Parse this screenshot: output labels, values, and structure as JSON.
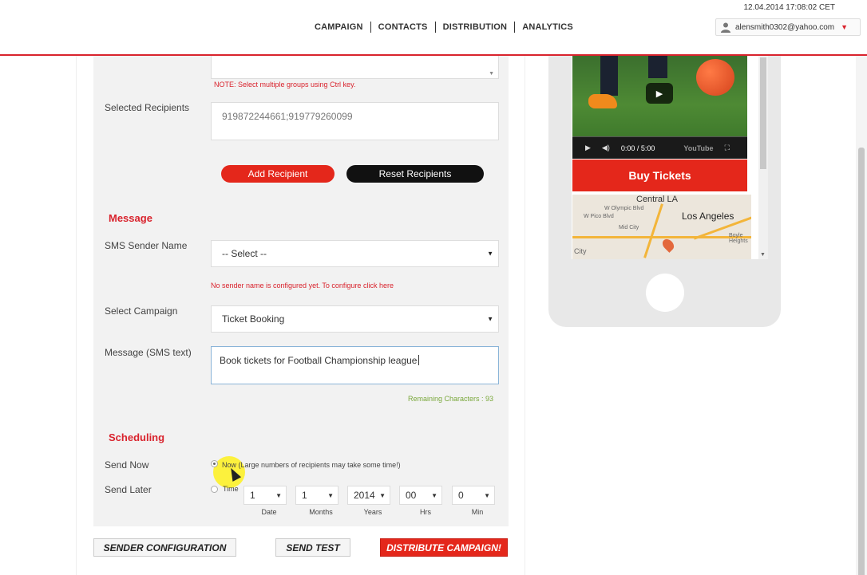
{
  "header": {
    "datetime": "12.04.2014 17:08:02 CET",
    "nav": [
      "CAMPAIGN",
      "CONTACTS",
      "DISTRIBUTION",
      "ANALYTICS"
    ],
    "user_email": "alensmith0302@yahoo.com"
  },
  "recipients": {
    "groups_note": "NOTE: Select multiple groups using Ctrl key.",
    "selected_label": "Selected Recipients",
    "selected_value": "919872244661;919779260099",
    "add_button": "Add Recipient",
    "reset_button": "Reset Recipients"
  },
  "message": {
    "section_title": "Message",
    "sender_label": "SMS Sender Name",
    "sender_value": "-- Select --",
    "sender_note": "No sender name is configured yet. To configure click here",
    "campaign_label": "Select Campaign",
    "campaign_value": "Ticket Booking",
    "sms_label": "Message (SMS text)",
    "sms_value": "Book tickets for Football Championship league",
    "remaining": "Remaining Characters : 93"
  },
  "scheduling": {
    "section_title": "Scheduling",
    "send_now_label": "Send Now",
    "send_now_option": "Now (Large numbers of recipients may take some time!)",
    "send_later_label": "Send Later",
    "time_label": "Time",
    "fields": [
      {
        "value": "1",
        "label": "Date"
      },
      {
        "value": "1",
        "label": "Months"
      },
      {
        "value": "2014",
        "label": "Years"
      },
      {
        "value": "00",
        "label": "Hrs"
      },
      {
        "value": "0",
        "label": "Min"
      }
    ]
  },
  "actions": {
    "sender_config": "SENDER CONFIGURATION",
    "send_test": "SEND TEST",
    "distribute": "DISTRIBUTE CAMPAIGN!"
  },
  "preview": {
    "video_time": "0:00 / 5:00",
    "video_brand": "YouTube",
    "buy_button": "Buy Tickets",
    "map_labels": {
      "central": "Central LA",
      "la": "Los Angeles",
      "pico": "W Pico Blvd",
      "olympic": "W Olympic Blvd",
      "mid_city": "Mid City",
      "city": "City",
      "boyle": "Boyle Heights"
    }
  },
  "colors": {
    "accent": "#d9232d",
    "dark_button": "#111111",
    "remaining_text": "#7aa83c"
  }
}
